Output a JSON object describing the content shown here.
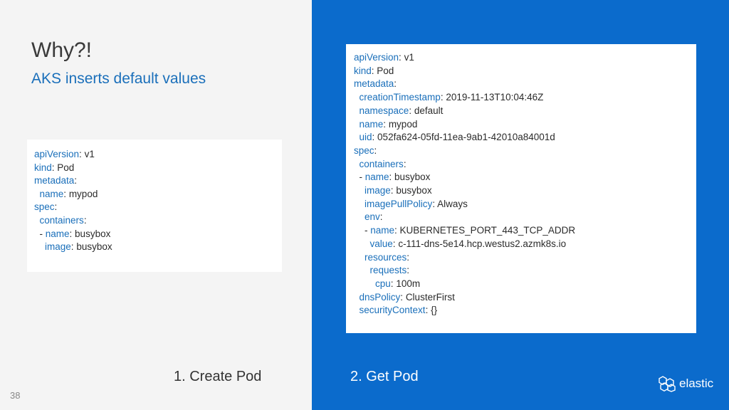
{
  "slide": {
    "title": "Why?!",
    "subtitle": "AKS inserts default values",
    "page_number": "38",
    "brand": "elastic",
    "caption_left": "1. Create Pod",
    "caption_right": "2. Get Pod",
    "colors": {
      "left_background": "#f4f4f4",
      "right_background": "#0b6bcc",
      "key": "#1a6fba"
    }
  },
  "code_left": [
    {
      "indent": "",
      "key": "apiVersion",
      "sep": ": ",
      "value": "v1"
    },
    {
      "indent": "",
      "key": "kind",
      "sep": ": ",
      "value": "Pod"
    },
    {
      "indent": "",
      "key": "metadata",
      "sep": ":",
      "value": ""
    },
    {
      "indent": "  ",
      "key": "name",
      "sep": ": ",
      "value": "mypod"
    },
    {
      "indent": "",
      "key": "spec",
      "sep": ":",
      "value": ""
    },
    {
      "indent": "  ",
      "key": "containers",
      "sep": ":",
      "value": ""
    },
    {
      "indent": "  - ",
      "key": "name",
      "sep": ": ",
      "value": "busybox"
    },
    {
      "indent": "    ",
      "key": "image",
      "sep": ": ",
      "value": "busybox"
    }
  ],
  "code_right": [
    {
      "indent": "",
      "key": "apiVersion",
      "sep": ": ",
      "value": "v1"
    },
    {
      "indent": "",
      "key": "kind",
      "sep": ": ",
      "value": "Pod"
    },
    {
      "indent": "",
      "key": "metadata",
      "sep": ":",
      "value": ""
    },
    {
      "indent": "  ",
      "key": "creationTimestamp",
      "sep": ": ",
      "value": "2019-11-13T10:04:46Z"
    },
    {
      "indent": "  ",
      "key": "namespace",
      "sep": ": ",
      "value": "default"
    },
    {
      "indent": "  ",
      "key": "name",
      "sep": ": ",
      "value": "mypod"
    },
    {
      "indent": "  ",
      "key": "uid",
      "sep": ": ",
      "value": "052fa624-05fd-11ea-9ab1-42010a84001d"
    },
    {
      "indent": "",
      "key": "spec",
      "sep": ":",
      "value": ""
    },
    {
      "indent": "  ",
      "key": "containers",
      "sep": ":",
      "value": ""
    },
    {
      "indent": "  - ",
      "key": "name",
      "sep": ": ",
      "value": "busybox"
    },
    {
      "indent": "    ",
      "key": "image",
      "sep": ": ",
      "value": "busybox"
    },
    {
      "indent": "    ",
      "key": "imagePullPolicy",
      "sep": ": ",
      "value": "Always"
    },
    {
      "indent": "    ",
      "key": "env",
      "sep": ":",
      "value": ""
    },
    {
      "indent": "    - ",
      "key": "name",
      "sep": ": ",
      "value": "KUBERNETES_PORT_443_TCP_ADDR"
    },
    {
      "indent": "      ",
      "key": "value",
      "sep": ": ",
      "value": "c-111-dns-5e14.hcp.westus2.azmk8s.io"
    },
    {
      "indent": "    ",
      "key": "resources",
      "sep": ":",
      "value": ""
    },
    {
      "indent": "      ",
      "key": "requests",
      "sep": ":",
      "value": ""
    },
    {
      "indent": "        ",
      "key": "cpu",
      "sep": ": ",
      "value": "100m"
    },
    {
      "indent": "  ",
      "key": "dnsPolicy",
      "sep": ": ",
      "value": "ClusterFirst"
    },
    {
      "indent": "  ",
      "key": "securityContext",
      "sep": ": ",
      "value": "{}"
    }
  ]
}
